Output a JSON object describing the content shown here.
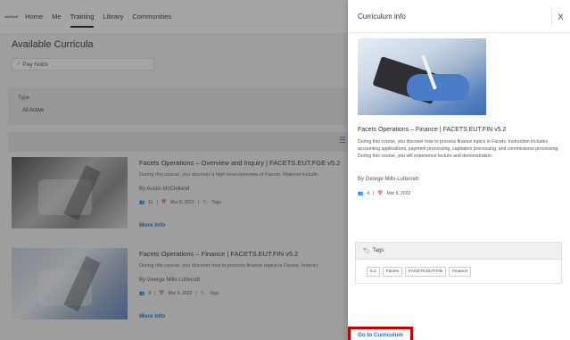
{
  "nav": {
    "brand": "skillsoft",
    "items": [
      {
        "label": "Home"
      },
      {
        "label": "Me"
      },
      {
        "label": "Training"
      },
      {
        "label": "Library"
      },
      {
        "label": "Communities"
      }
    ]
  },
  "page": {
    "title": "Available Curricula",
    "search_value": "Pay holds",
    "filter_label": "Type",
    "filter_value": "All Active"
  },
  "cards": [
    {
      "title": "Facets Operations – Overview and Inquiry | FACETS.EUT.FGE v5.2",
      "desc": "During this course, you discover a high-level overview of Facets. Material include",
      "author": "By Austin McClelland",
      "count": "11",
      "date": "Mar 8, 2023",
      "tags_label": "Tags",
      "more": "More Info"
    },
    {
      "title": "Facets Operations – Finance | FACETS.EUT.FIN v5.2",
      "desc": "During this course, you discover how to process finance topics in Facets. Instruct",
      "author": "By George Mills-Lutterodt",
      "count": "4",
      "date": "Mar 9, 2022",
      "tags_label": "Tags",
      "more": "More Info"
    }
  ],
  "panel": {
    "title": "Curriculum info",
    "close": "X",
    "course_title": "Facets Operations – Finance | FACETS.EUT.FIN v5.2",
    "course_desc": "During this course, you discover how to process finance topics in Facets. Instruction includes accounting applications, payment processing, capitation processing, and commissions processing. During this course, you will experience lecture and demonstration.",
    "author": "By George Mills-Lutterodt",
    "count": "4",
    "date": "Mar 9, 2022",
    "tags_title": "Tags",
    "tags": [
      "5.2",
      "Facets",
      "FACETS.EUT.FIN",
      "Finance"
    ],
    "go_button": "Go to Curriculum"
  },
  "colors": {
    "accent": "#2a6db0",
    "highlight_border": "#c00000"
  }
}
